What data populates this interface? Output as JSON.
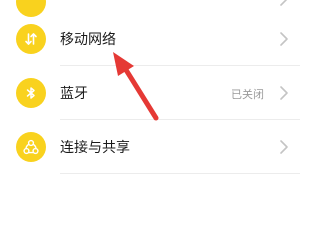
{
  "settings": {
    "items": [
      {
        "label": "移动网络",
        "value": "",
        "icon": "mobile-data-icon"
      },
      {
        "label": "蓝牙",
        "value": "已关闭",
        "icon": "bluetooth-icon"
      },
      {
        "label": "连接与共享",
        "value": "",
        "icon": "connection-share-icon"
      }
    ]
  },
  "colors": {
    "icon_background": "#f9d21e",
    "annotation_arrow": "#e53935"
  }
}
